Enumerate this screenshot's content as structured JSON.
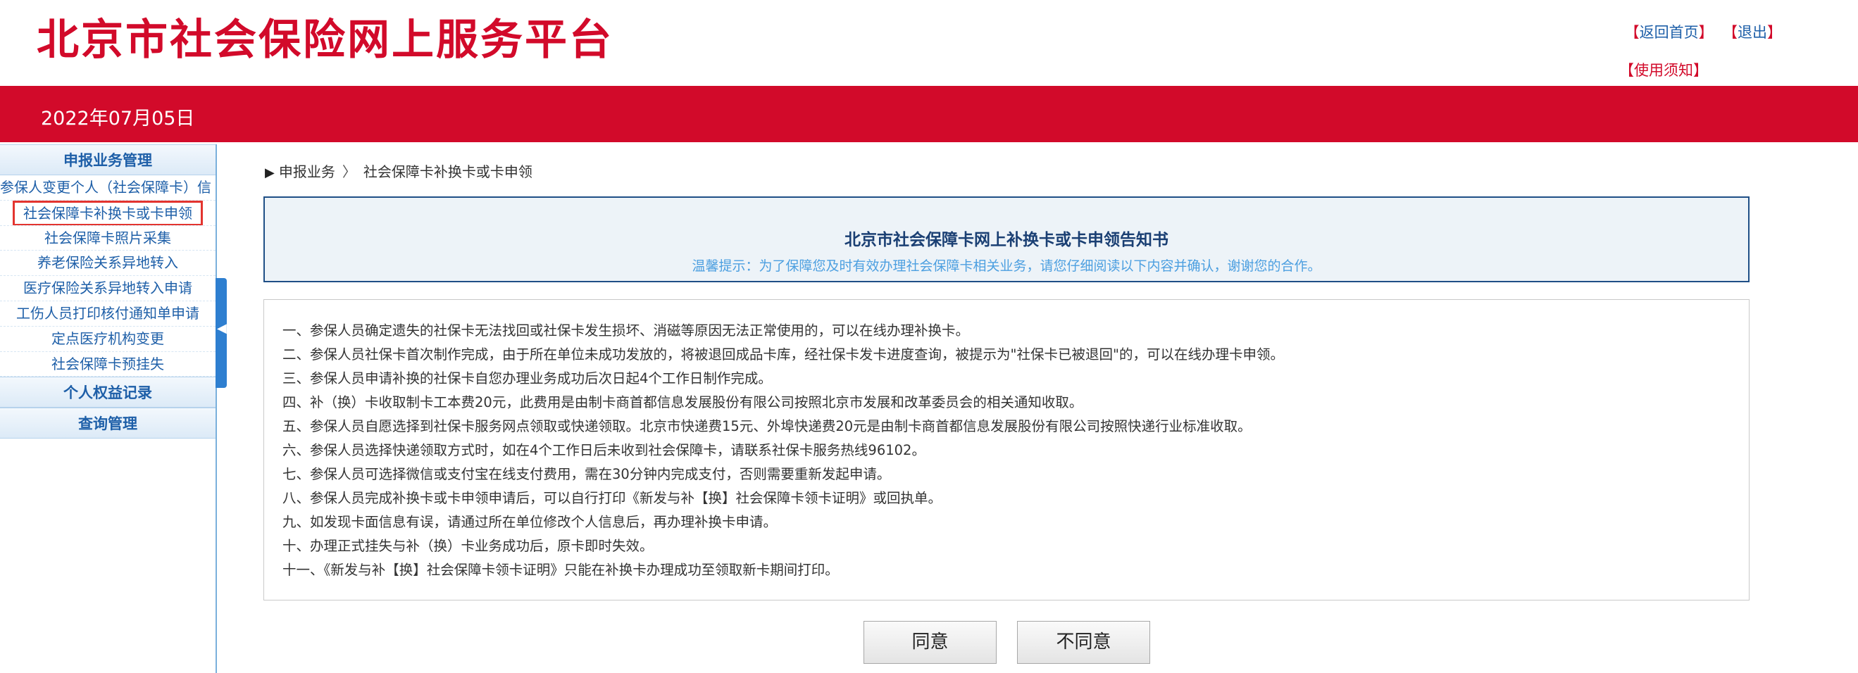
{
  "header": {
    "site_title": "北京市社会保险网上服务平台",
    "bracket_open": "【",
    "bracket_close": "】",
    "home_link": "返回首页",
    "logout_link": "退出",
    "usage_notice_link": "使用须知",
    "date": "2022年07月05日"
  },
  "sidebar": {
    "section_1": "申报业务管理",
    "items": [
      "参保人变更个人（社会保障卡）信",
      "社会保障卡补换卡或卡申领",
      "社会保障卡照片采集",
      "养老保险关系异地转入",
      "医疗保险关系异地转入申请",
      "工伤人员打印核付通知单申请",
      "定点医疗机构变更",
      "社会保障卡预挂失"
    ],
    "section_2": "个人权益记录",
    "section_3": "查询管理",
    "collapse_glyph": "◀"
  },
  "breadcrumb": {
    "arrow": "▶",
    "level1": "申报业务",
    "separator": "〉",
    "level2": "社会保障卡补换卡或卡申领"
  },
  "notice": {
    "title": "北京市社会保障卡网上补换卡或卡申领告知书",
    "tip": "温馨提示：为了保障您及时有效办理社会保障卡相关业务，请您仔细阅读以下内容并确认，谢谢您的合作。"
  },
  "terms": [
    "一、参保人员确定遗失的社保卡无法找回或社保卡发生损坏、消磁等原因无法正常使用的，可以在线办理补换卡。",
    "二、参保人员社保卡首次制作完成，由于所在单位未成功发放的，将被退回成品卡库，经社保卡发卡进度查询，被提示为\"社保卡已被退回\"的，可以在线办理卡申领。",
    "三、参保人员申请补换的社保卡自您办理业务成功后次日起4个工作日制作完成。",
    "四、补（换）卡收取制卡工本费20元，此费用是由制卡商首都信息发展股份有限公司按照北京市发展和改革委员会的相关通知收取。",
    "五、参保人员自愿选择到社保卡服务网点领取或快递领取。北京市快递费15元、外埠快递费20元是由制卡商首都信息发展股份有限公司按照快递行业标准收取。",
    "六、参保人员选择快递领取方式时，如在4个工作日后未收到社会保障卡，请联系社保卡服务热线96102。",
    "七、参保人员可选择微信或支付宝在线支付费用，需在30分钟内完成支付，否则需要重新发起申请。",
    "八、参保人员完成补换卡或卡申领申请后，可以自行打印《新发与补【换】社会保障卡领卡证明》或回执单。",
    "九、如发现卡面信息有误，请通过所在单位修改个人信息后，再办理补换卡申请。",
    "十、办理正式挂失与补（换）卡业务成功后，原卡即时失效。",
    "十一、《新发与补【换】社会保障卡领卡证明》只能在补换卡办理成功至领取新卡期间打印。"
  ],
  "buttons": {
    "agree": "同意",
    "disagree": "不同意"
  },
  "colors": {
    "brand_red": "#d20a2a",
    "link_blue": "#1e5fa8",
    "notice_border": "#1f4f86",
    "tip_blue": "#4c9fe0"
  }
}
